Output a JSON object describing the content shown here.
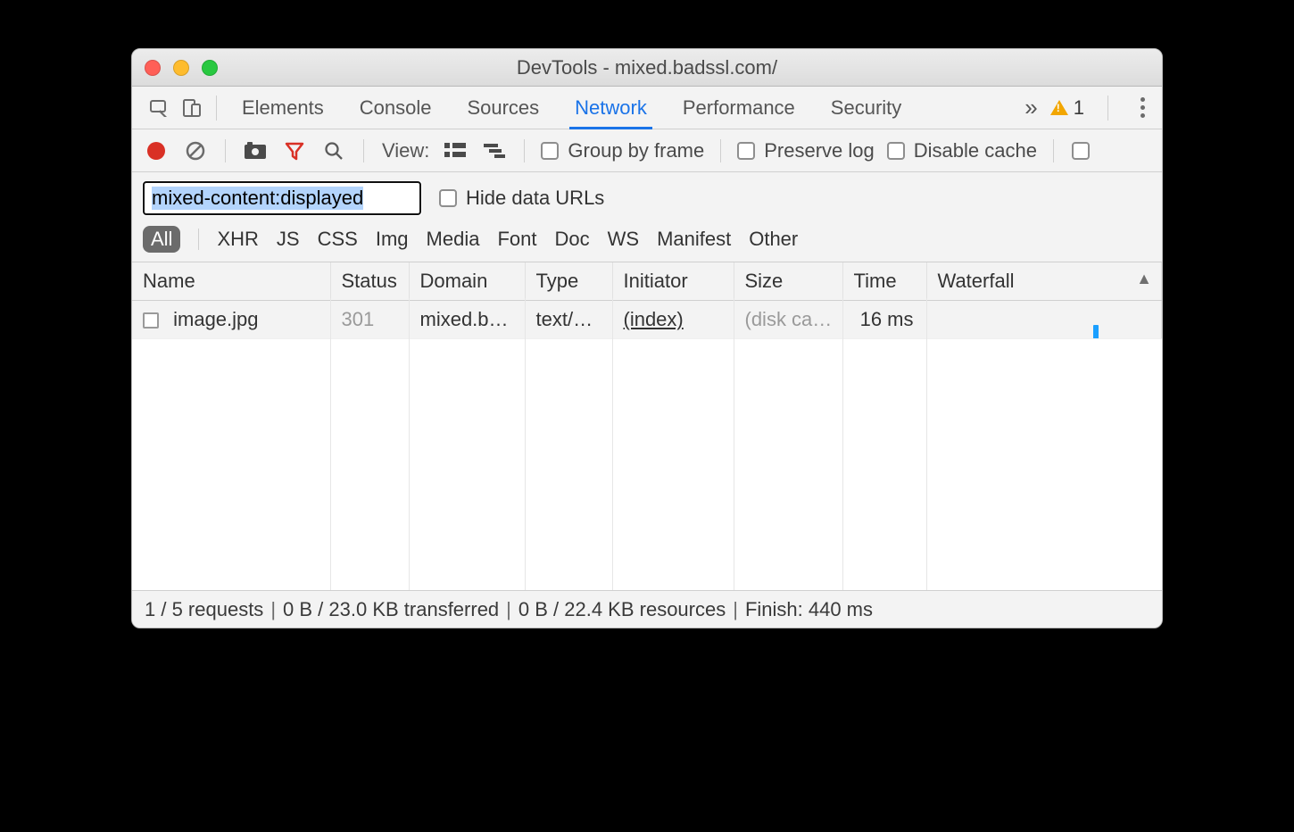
{
  "window": {
    "title": "DevTools - mixed.badssl.com/"
  },
  "tabs": {
    "items": [
      "Elements",
      "Console",
      "Sources",
      "Network",
      "Performance",
      "Security"
    ],
    "active": "Network",
    "warnings_count": "1"
  },
  "toolbar": {
    "view_label": "View:",
    "group_by_frame": "Group by frame",
    "preserve_log": "Preserve log",
    "disable_cache": "Disable cache"
  },
  "filter": {
    "value": "mixed-content:displayed",
    "hide_data_urls": "Hide data URLs"
  },
  "type_filters": {
    "items": [
      "All",
      "XHR",
      "JS",
      "CSS",
      "Img",
      "Media",
      "Font",
      "Doc",
      "WS",
      "Manifest",
      "Other"
    ],
    "active": "All"
  },
  "columns": {
    "name": "Name",
    "status": "Status",
    "domain": "Domain",
    "type": "Type",
    "initiator": "Initiator",
    "size": "Size",
    "time": "Time",
    "waterfall": "Waterfall"
  },
  "rows": [
    {
      "name": "image.jpg",
      "status": "301",
      "domain": "mixed.b…",
      "type": "text/h…",
      "initiator": "(index)",
      "size": "(disk ca…",
      "time": "16 ms"
    }
  ],
  "status": {
    "requests": "1 / 5 requests",
    "transferred": "0 B / 23.0 KB transferred",
    "resources": "0 B / 22.4 KB resources",
    "finish": "Finish: 440 ms"
  }
}
